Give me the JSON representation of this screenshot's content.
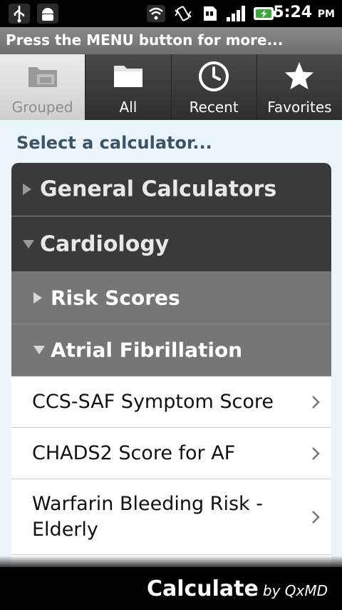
{
  "status_bar": {
    "time": "5:24",
    "ampm": "PM",
    "icons": [
      "usb-icon",
      "android-icon",
      "wifi-icon",
      "vibrate-icon",
      "sd-card-icon",
      "signal-icon",
      "battery-charging-icon"
    ]
  },
  "hint": "Press the MENU button for more...",
  "tabs": [
    {
      "label": "Grouped",
      "icon": "grouped-folder-icon",
      "active": true
    },
    {
      "label": "All",
      "icon": "folder-icon",
      "active": false
    },
    {
      "label": "Recent",
      "icon": "clock-icon",
      "active": false
    },
    {
      "label": "Favorites",
      "icon": "star-icon",
      "active": false
    }
  ],
  "prompt": "Select a calculator...",
  "list": {
    "categories": [
      {
        "label": "General Calculators",
        "expanded": false
      },
      {
        "label": "Cardiology",
        "expanded": true
      }
    ],
    "subcategories": [
      {
        "label": "Risk Scores",
        "expanded": false
      },
      {
        "label": "Atrial Fibrillation",
        "expanded": true
      }
    ],
    "items": [
      {
        "label": "CCS-SAF Symptom Score"
      },
      {
        "label": "CHADS2 Score for AF"
      },
      {
        "label": "Warfarin Bleeding Risk - Elderly"
      }
    ]
  },
  "footer": {
    "brand": "Calculate",
    "by": "by QxMD"
  },
  "colors": {
    "category_bg": "#3a3a3a",
    "subcategory_bg": "#767676",
    "page_bg": "#eaf4fb",
    "prompt_text": "#3d5466"
  }
}
